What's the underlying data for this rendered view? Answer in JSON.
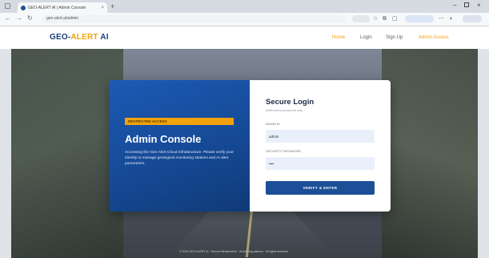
{
  "browser": {
    "tab_title": "GEO-ALERT AI | Admin Console",
    "tab_close": "×",
    "new_tab": "+",
    "url": "geo-alert.ai/admin",
    "controls": {
      "minimize": "–",
      "close": "×"
    },
    "nav": {
      "back": "←",
      "forward": "→",
      "reload": "↻"
    }
  },
  "header": {
    "brand": {
      "part1": "GEO-",
      "part2": "ALERT",
      "part3": " AI"
    },
    "nav": {
      "home": "Home",
      "login": "Login",
      "signup": "Sign Up",
      "admin": "Admin Access"
    }
  },
  "console": {
    "badge": "RESTRICTED ACCESS",
    "title": "Admin Console",
    "description": "Accessing the Geo-Alert Cloud Infrastructure. Please verify your identity to manage geological monitoring stations and AI alert parameters."
  },
  "login": {
    "title": "Secure Login",
    "subtitle": "Authorized personnel only",
    "admin_label": "ADMIN ID",
    "admin_value": "admin",
    "password_label": "SECURITY PASSWORD",
    "password_value": "••••",
    "submit_label": "VERIFY & ENTER"
  },
  "footer": {
    "text": "© 2024 GEO-ALERT AI · Secure Infrastructure · Monitoring stations · All rights reserved"
  },
  "colors": {
    "brand_navy": "#173f7a",
    "brand_gold": "#f2a20c",
    "panel_blue": "#164a96",
    "button_blue": "#1b4f98",
    "field_bg": "#e9f0fb"
  }
}
